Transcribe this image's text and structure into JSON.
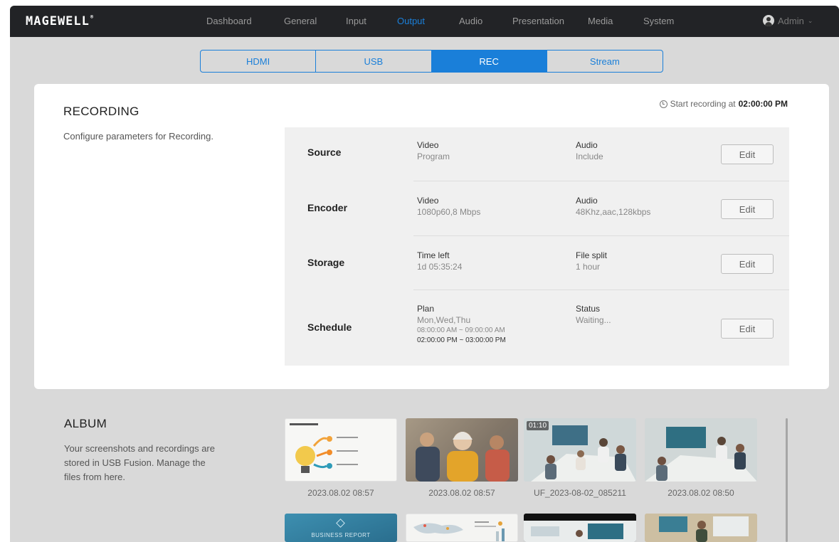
{
  "brand": {
    "logo": "MAGEWELL",
    "logo_mark": "®"
  },
  "nav": {
    "items": [
      {
        "label": "Dashboard"
      },
      {
        "label": "General"
      },
      {
        "label": "Input"
      },
      {
        "label": "Output",
        "active": true
      },
      {
        "label": "Audio"
      },
      {
        "label": "Presentation"
      },
      {
        "label": "Media"
      },
      {
        "label": "System"
      }
    ],
    "user": "Admin"
  },
  "tabs": [
    {
      "label": "HDMI"
    },
    {
      "label": "USB"
    },
    {
      "label": "REC",
      "active": true
    },
    {
      "label": "Stream"
    }
  ],
  "recording": {
    "title": "RECORDING",
    "description": "Configure parameters for Recording.",
    "start_prefix": "Start recording at",
    "start_time": "02:00:00 PM",
    "rows": [
      {
        "label": "Source",
        "col1_title": "Video",
        "col1_value": "Program",
        "col2_title": "Audio",
        "col2_value": "Include",
        "edit": "Edit"
      },
      {
        "label": "Encoder",
        "col1_title": "Video",
        "col1_value": "1080p60,8 Mbps",
        "col2_title": "Audio",
        "col2_value": "48Khz,aac,128kbps",
        "edit": "Edit"
      },
      {
        "label": "Storage",
        "col1_title": "Time left",
        "col1_value": "1d 05:35:24",
        "col2_title": "File split",
        "col2_value": "1 hour",
        "edit": "Edit"
      },
      {
        "label": "Schedule",
        "col1_title": "Plan",
        "col1_value": "Mon,Wed,Thu",
        "col1_time1": "08:00:00 AM ~ 09:00:00 AM",
        "col1_time2": "02:00:00 PM ~ 03:00:00 PM",
        "col2_title": "Status",
        "col2_value": "Waiting...",
        "edit": "Edit"
      }
    ]
  },
  "album": {
    "title": "ALBUM",
    "description_lines": [
      "Your screenshots and recordings are",
      "stored in USB Fusion. Manage the",
      "files from here."
    ],
    "items": [
      {
        "caption": "2023.08.02 08:57",
        "kind": "slide-screenshot"
      },
      {
        "caption": "2023.08.02 08:57",
        "kind": "people-photo"
      },
      {
        "caption": "UF_2023-08-02_085211",
        "kind": "meeting-video",
        "duration": "01:10"
      },
      {
        "caption": "2023.08.02 08:50",
        "kind": "meeting-photo"
      }
    ],
    "second_row": [
      {
        "kind": "business-report",
        "text": "BUSINESS REPORT"
      },
      {
        "kind": "map-slide"
      },
      {
        "kind": "dark-slide"
      },
      {
        "kind": "presenter-photo"
      }
    ]
  },
  "colors": {
    "accent": "#1a7fd9",
    "topbar": "#222326",
    "page_bg": "#d9d9d9"
  }
}
